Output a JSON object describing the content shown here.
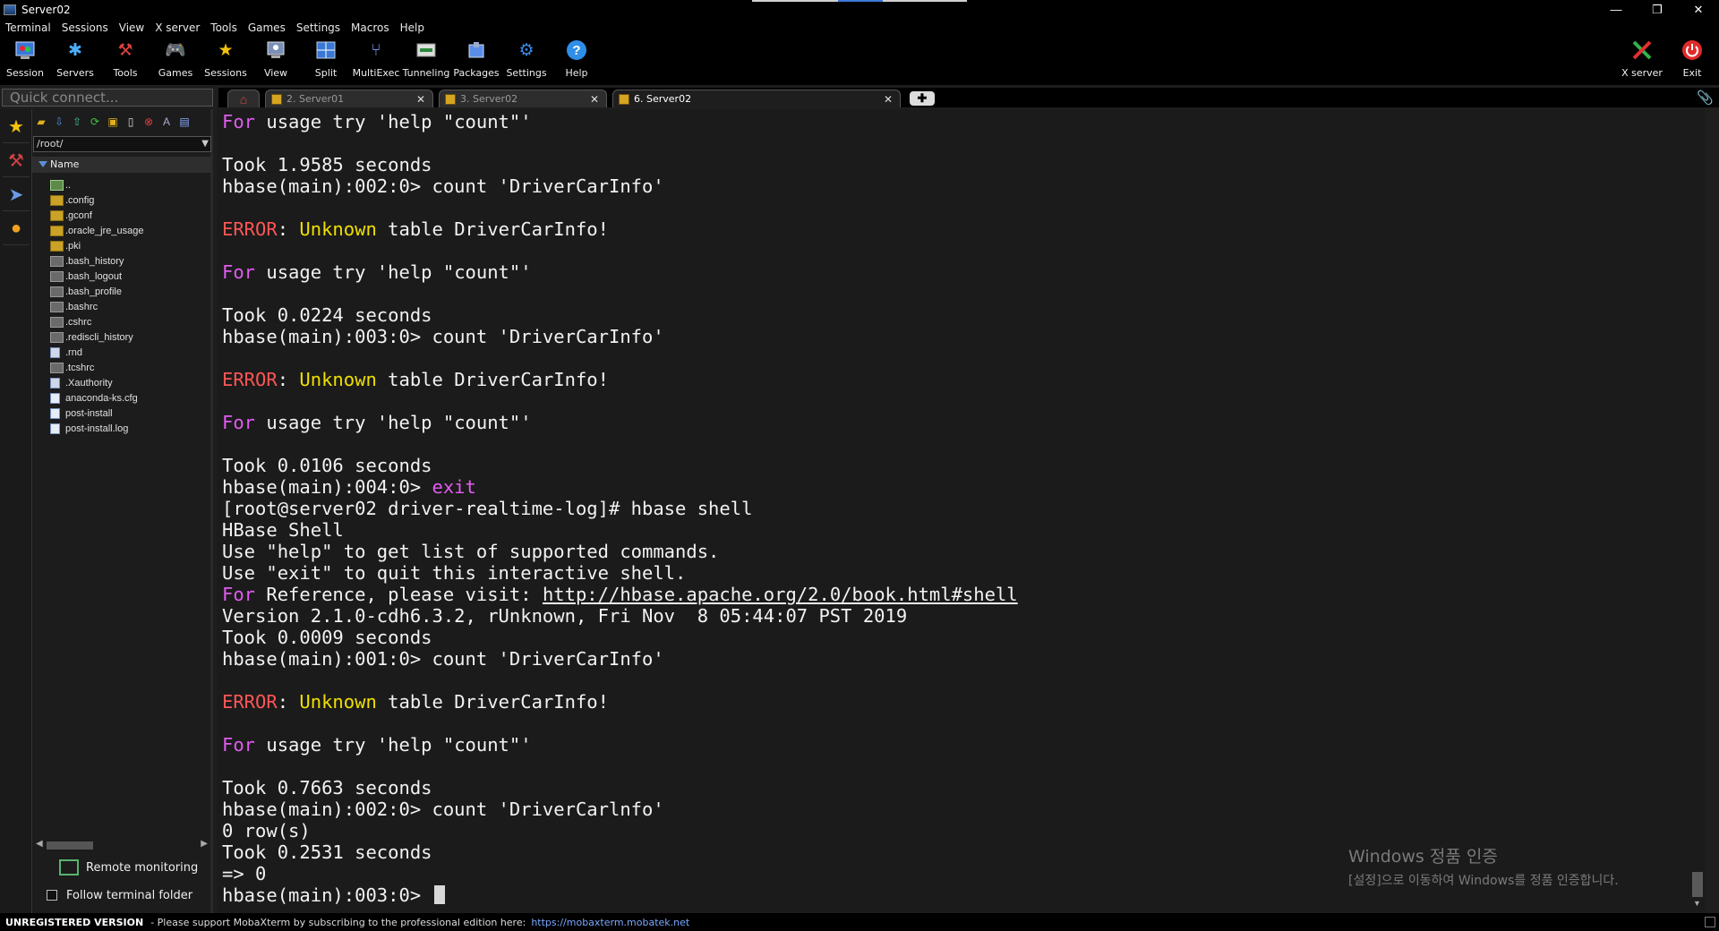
{
  "window": {
    "title": "Server02",
    "controls": [
      "—",
      "❐",
      "✕"
    ]
  },
  "menu": [
    "Terminal",
    "Sessions",
    "View",
    "X server",
    "Tools",
    "Games",
    "Settings",
    "Macros",
    "Help"
  ],
  "toolbar": {
    "items": [
      {
        "label": "Session",
        "icon": "session-icon"
      },
      {
        "label": "Servers",
        "icon": "servers-icon"
      },
      {
        "label": "Tools",
        "icon": "tools-icon"
      },
      {
        "label": "Games",
        "icon": "games-icon"
      },
      {
        "label": "Sessions",
        "icon": "star-icon"
      },
      {
        "label": "View",
        "icon": "view-icon"
      },
      {
        "label": "Split",
        "icon": "split-icon"
      },
      {
        "label": "MultiExec",
        "icon": "multiexec-icon"
      },
      {
        "label": "Tunneling",
        "icon": "tunneling-icon"
      },
      {
        "label": "Packages",
        "icon": "packages-icon"
      },
      {
        "label": "Settings",
        "icon": "settings-icon"
      },
      {
        "label": "Help",
        "icon": "help-icon"
      }
    ],
    "right": [
      {
        "label": "X server",
        "icon": "xserver-icon"
      },
      {
        "label": "Exit",
        "icon": "power-icon"
      }
    ]
  },
  "quick_connect": {
    "placeholder": "Quick connect..."
  },
  "tabs": [
    {
      "label": "2. Server01",
      "active": false
    },
    {
      "label": "3. Server02",
      "active": false
    },
    {
      "label": "6. Server02",
      "active": true
    }
  ],
  "file_browser": {
    "path": "/root/",
    "column": "Name",
    "files": [
      {
        "name": "..",
        "kind": "up"
      },
      {
        "name": ".config",
        "kind": "folder"
      },
      {
        "name": ".gconf",
        "kind": "folder"
      },
      {
        "name": ".oracle_jre_usage",
        "kind": "folder"
      },
      {
        "name": ".pki",
        "kind": "folder"
      },
      {
        "name": ".bash_history",
        "kind": "hidden"
      },
      {
        "name": ".bash_logout",
        "kind": "hidden"
      },
      {
        "name": ".bash_profile",
        "kind": "hidden"
      },
      {
        "name": ".bashrc",
        "kind": "hidden"
      },
      {
        "name": ".cshrc",
        "kind": "hidden"
      },
      {
        "name": ".rediscli_history",
        "kind": "hidden"
      },
      {
        "name": ".rnd",
        "kind": "doc2"
      },
      {
        "name": ".tcshrc",
        "kind": "hidden"
      },
      {
        "name": ".Xauthority",
        "kind": "doc2"
      },
      {
        "name": "anaconda-ks.cfg",
        "kind": "doc"
      },
      {
        "name": "post-install",
        "kind": "doc"
      },
      {
        "name": "post-install.log",
        "kind": "doc"
      }
    ],
    "remote_monitoring": "Remote monitoring",
    "follow_terminal_folder": "Follow terminal folder"
  },
  "terminal": {
    "lines": [
      [
        [
          "For",
          "mag"
        ],
        [
          " usage try 'help \"count\"'",
          ""
        ]
      ],
      [],
      [
        [
          "Took 1.9585 seconds",
          ""
        ]
      ],
      [
        [
          "hbase(main):002:0> count 'DriverCarInfo'",
          ""
        ]
      ],
      [],
      [
        [
          "ERROR",
          "red"
        ],
        [
          ": ",
          ""
        ],
        [
          "Unknown",
          "yel"
        ],
        [
          " table DriverCarInfo!",
          ""
        ]
      ],
      [],
      [
        [
          "For",
          "mag"
        ],
        [
          " usage try 'help \"count\"'",
          ""
        ]
      ],
      [],
      [
        [
          "Took 0.0224 seconds",
          ""
        ]
      ],
      [
        [
          "hbase(main):003:0> count 'DriverCarInfo'",
          ""
        ]
      ],
      [],
      [
        [
          "ERROR",
          "red"
        ],
        [
          ": ",
          ""
        ],
        [
          "Unknown",
          "yel"
        ],
        [
          " table DriverCarInfo!",
          ""
        ]
      ],
      [],
      [
        [
          "For",
          "mag"
        ],
        [
          " usage try 'help \"count\"'",
          ""
        ]
      ],
      [],
      [
        [
          "Took 0.0106 seconds",
          ""
        ]
      ],
      [
        [
          "hbase(main):004:0> ",
          ""
        ],
        [
          "exit",
          "mag"
        ]
      ],
      [
        [
          "[root@server02 driver-realtime-log]# hbase shell",
          ""
        ]
      ],
      [
        [
          "HBase Shell",
          ""
        ]
      ],
      [
        [
          "Use \"help\" to get list of supported commands.",
          ""
        ]
      ],
      [
        [
          "Use \"exit\" to quit this interactive shell.",
          ""
        ]
      ],
      [
        [
          "For",
          "mag"
        ],
        [
          " Reference, please visit: ",
          ""
        ],
        [
          "http://hbase.apache.org/2.0/book.html#shell",
          "url"
        ]
      ],
      [
        [
          "Version 2.1.0-cdh6.3.2, rUnknown, Fri Nov  8 05:44:07 PST 2019",
          ""
        ]
      ],
      [
        [
          "Took 0.0009 seconds",
          ""
        ]
      ],
      [
        [
          "hbase(main):001:0> count 'DriverCarInfo'",
          ""
        ]
      ],
      [],
      [
        [
          "ERROR",
          "red"
        ],
        [
          ": ",
          ""
        ],
        [
          "Unknown",
          "yel"
        ],
        [
          " table DriverCarInfo!",
          ""
        ]
      ],
      [],
      [
        [
          "For",
          "mag"
        ],
        [
          " usage try 'help \"count\"'",
          ""
        ]
      ],
      [],
      [
        [
          "Took 0.7663 seconds",
          ""
        ]
      ],
      [
        [
          "hbase(main):002:0> count 'DriverCarlnfo'",
          ""
        ]
      ],
      [
        [
          "0 row(s)",
          ""
        ]
      ],
      [
        [
          "Took 0.2531 seconds",
          ""
        ]
      ],
      [
        [
          "=> 0",
          ""
        ]
      ],
      [
        [
          "hbase(main):003:0> ",
          ""
        ]
      ]
    ]
  },
  "watermark": {
    "line1": "Windows 정품 인증",
    "line2": "[설정]으로 이동하여 Windows를 정품 인증합니다."
  },
  "status": {
    "unregistered": "UNREGISTERED VERSION",
    "message": " -  Please support MobaXterm by subscribing to the professional edition here:",
    "link": "https://mobaxterm.mobatek.net"
  }
}
